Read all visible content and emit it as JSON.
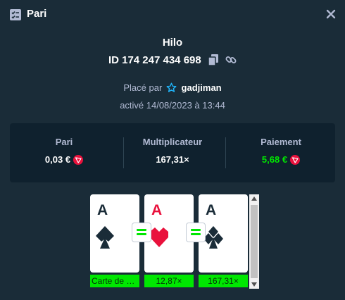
{
  "header": {
    "title": "Pari",
    "icon": "bet-slip-icon",
    "close_icon": "close-icon"
  },
  "game": {
    "name": "Hilo",
    "id_label": "ID 174 247 434 698",
    "placed_by_label": "Placé par",
    "username": "gadjiman",
    "activated_label": "activé 14/08/2023 à 13:44"
  },
  "stats": {
    "bet": {
      "label": "Pari",
      "value": "0,03 €"
    },
    "multiplier": {
      "label": "Multiplicateur",
      "value": "167,31×"
    },
    "payout": {
      "label": "Paiement",
      "value": "5,68 €"
    }
  },
  "cards": [
    {
      "rank": "A",
      "suit": "spade",
      "color": "#1a2c38",
      "label": "Carte de départ"
    },
    {
      "rank": "A",
      "suit": "heart",
      "color": "#e9113c",
      "label": "12,87×"
    },
    {
      "rank": "A",
      "suit": "club",
      "color": "#1a2c38",
      "label": "167,31×"
    }
  ],
  "colors": {
    "background": "#1a2c38",
    "panel": "#0f212e",
    "green": "#00e701",
    "muted": "#b1bad3",
    "red": "#e9113c",
    "star": "#1fb8ff"
  }
}
